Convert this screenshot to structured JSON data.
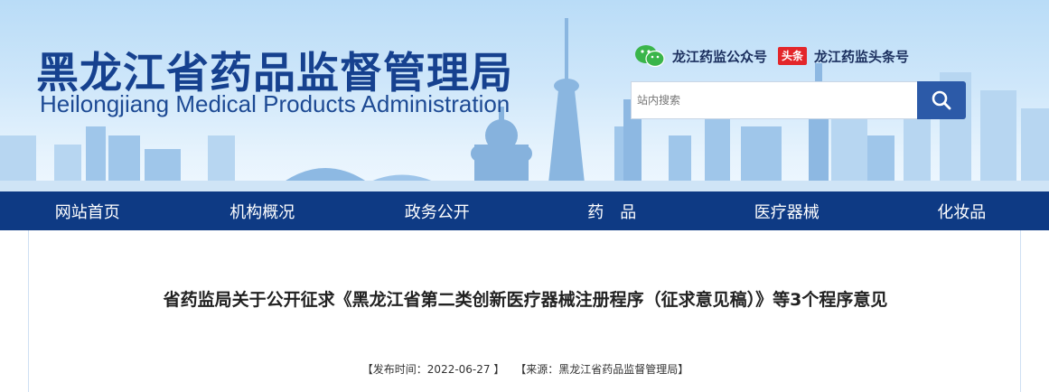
{
  "header": {
    "title_cn": "黑龙江省药品监督管理局",
    "title_en": "Heilongjiang Medical Products Administration",
    "wechat_label": "龙江药监公众号",
    "toutiao_badge": "头条",
    "toutiao_label": "龙江药监头条号",
    "search_placeholder": "站内搜索"
  },
  "nav": {
    "items": [
      {
        "label": "网站首页"
      },
      {
        "label": "机构概况"
      },
      {
        "label": "政务公开"
      },
      {
        "label": "药　品"
      },
      {
        "label": "医疗器械"
      },
      {
        "label": "化妆品"
      }
    ]
  },
  "article": {
    "title": "省药监局关于公开征求《黑龙江省第二类创新医疗器械注册程序（征求意见稿）》等3个程序意见",
    "publish_time": "【发布时间：2022-06-27 】",
    "source": "【来源：黑龙江省药品监督管理局】"
  },
  "colors": {
    "nav_bg": "#0e3a84",
    "title_blue": "#16418f",
    "search_button": "#2c5aa8",
    "toutiao_red": "#e3262a",
    "wechat_green": "#3ab54a"
  },
  "icons": [
    "wechat-icon",
    "toutiao-icon",
    "search-icon"
  ]
}
